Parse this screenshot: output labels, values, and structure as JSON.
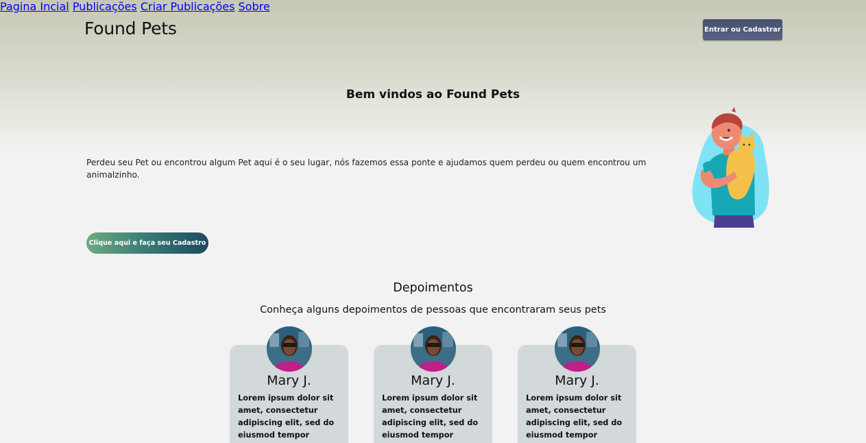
{
  "header": {
    "brand": "Found Pets",
    "nav": [
      {
        "label": "Pagina Incial"
      },
      {
        "label": "Publicações"
      },
      {
        "label": "Criar Publicações"
      },
      {
        "label": "Sobre"
      }
    ],
    "login_label": "Entrar ou Cadastrar"
  },
  "hero": {
    "title": "Bem vindos ao Found Pets",
    "text": "Perdeu seu Pet ou encontrou algum Pet aqui é o seu lugar, nós fazemos essa ponte e ajudamos quem perdeu ou quem encontrou um animalzinho.",
    "cta_label": "Clique aqui e faça seu Cadastro",
    "illustration": "boy-holding-cat-illustration"
  },
  "testimonials": {
    "title": "Depoimentos",
    "subtitle": "Conheça alguns depoimentos de pessoas que encontraram seus pets",
    "cards": [
      {
        "name": "Mary J.",
        "text": "Lorem ipsum dolor sit amet, consectetur adipiscing elit, sed do eiusmod tempor"
      },
      {
        "name": "Mary J.",
        "text": "Lorem ipsum dolor sit amet, consectetur adipiscing elit, sed do eiusmod tempor"
      },
      {
        "name": "Mary J.",
        "text": "Lorem ipsum dolor sit amet, consectetur adipiscing elit, sed do eiusmod tempor"
      }
    ]
  },
  "colors": {
    "login_button": "#4d5677",
    "cta_gradient_start": "#6daa80",
    "cta_gradient_end": "#1c4a60",
    "card_background": "#d3d8da"
  }
}
